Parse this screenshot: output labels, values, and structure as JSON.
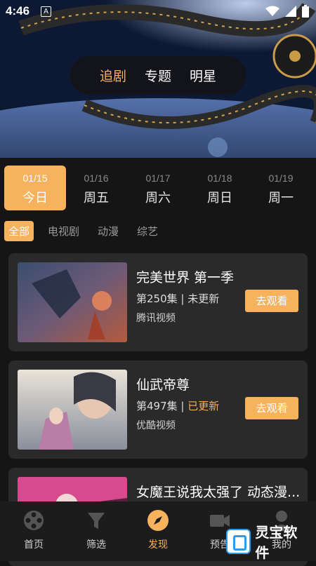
{
  "status": {
    "time": "4:46",
    "notif_icon": "A"
  },
  "segment": {
    "tabs": [
      "追剧",
      "专题",
      "明星"
    ],
    "active": 0
  },
  "dates": [
    {
      "date": "01/15",
      "day": "今日",
      "active": true
    },
    {
      "date": "01/16",
      "day": "周五",
      "active": false
    },
    {
      "date": "01/17",
      "day": "周六",
      "active": false
    },
    {
      "date": "01/18",
      "day": "周日",
      "active": false
    },
    {
      "date": "01/19",
      "day": "周一",
      "active": false
    }
  ],
  "categories": [
    "全部",
    "电视剧",
    "动漫",
    "综艺"
  ],
  "shows": [
    {
      "title": "完美世界 第一季",
      "episode": "第250集",
      "sep": " | ",
      "status": "未更新",
      "updated": false,
      "platform": "腾讯视频",
      "button": "去观看"
    },
    {
      "title": "仙武帝尊",
      "episode": "第497集",
      "sep": " | ",
      "status": "已更新",
      "updated": true,
      "platform": "优酷视频",
      "button": "去观看"
    },
    {
      "title": "女魔王说我太强了 动态漫...",
      "episode": "",
      "sep": "",
      "status": "",
      "updated": false,
      "platform": "",
      "button": ""
    }
  ],
  "tabbar": [
    {
      "label": "首页",
      "icon": "film-reel-icon",
      "active": false
    },
    {
      "label": "筛选",
      "icon": "funnel-icon",
      "active": false
    },
    {
      "label": "发现",
      "icon": "compass-icon",
      "active": true
    },
    {
      "label": "预告",
      "icon": "video-camera-icon",
      "active": false
    },
    {
      "label": "我的",
      "icon": "user-icon",
      "active": false
    }
  ],
  "watermark": {
    "text": "灵宝软件"
  },
  "colors": {
    "accent": "#f7b25e",
    "background": "#151515",
    "card": "#2a2a2a"
  }
}
